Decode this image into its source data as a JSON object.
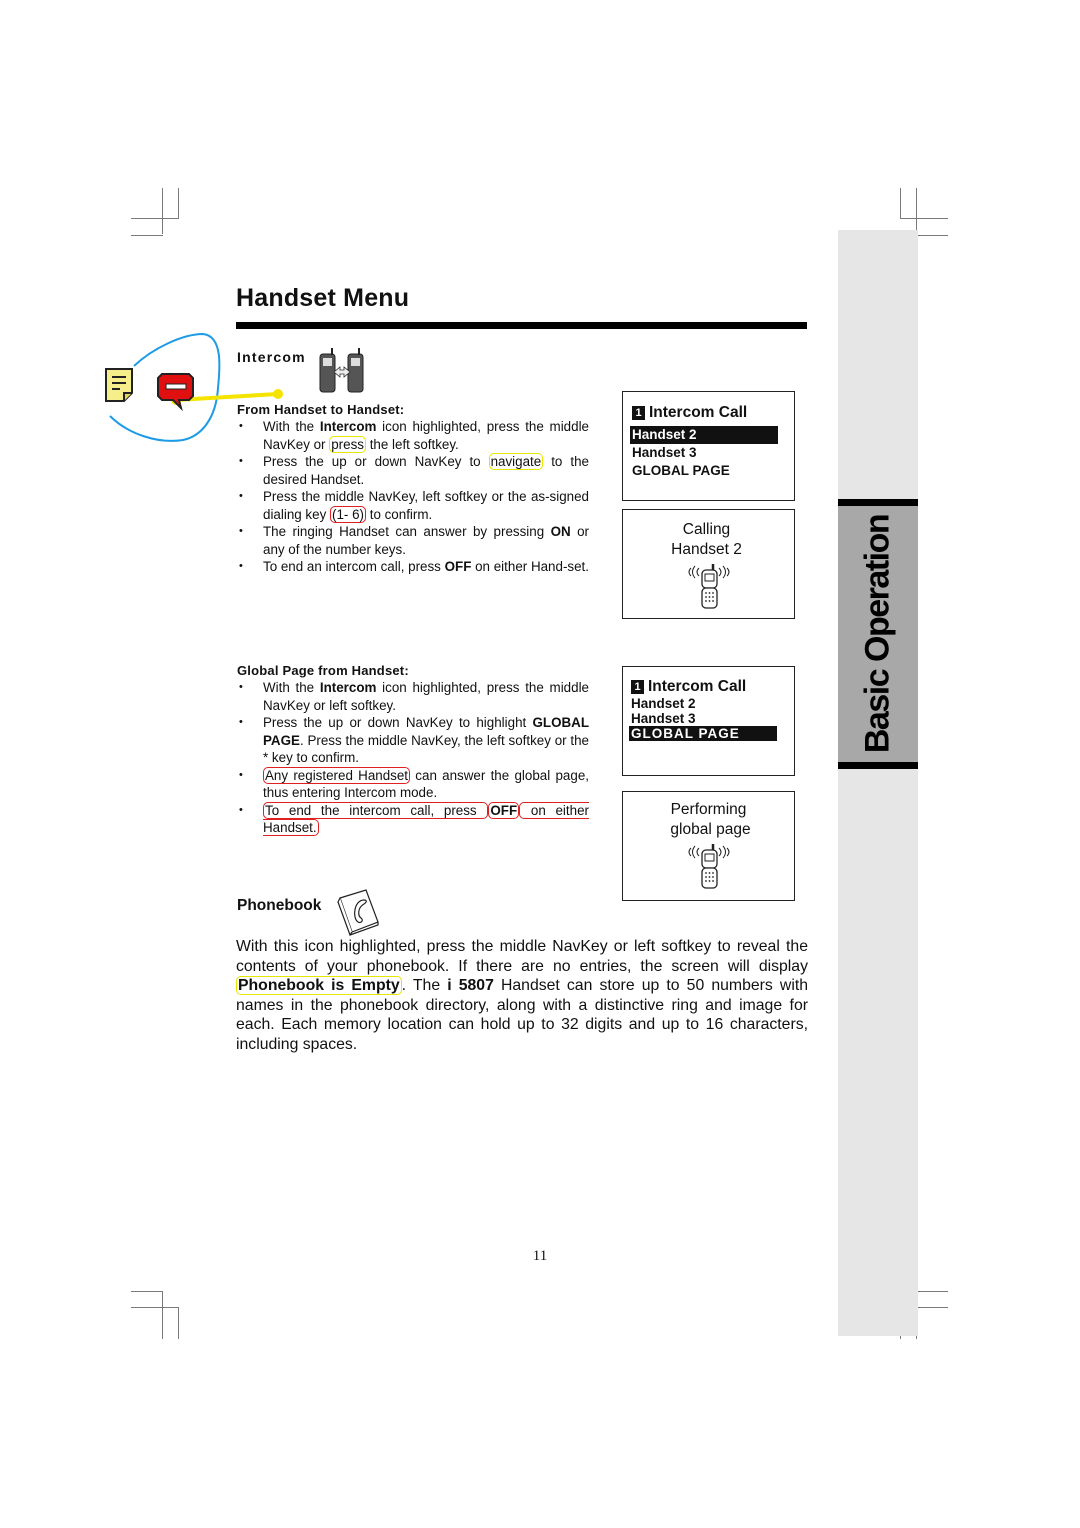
{
  "page": {
    "title": "Handset Menu",
    "side_tab": "Basic Operation",
    "page_number": "11"
  },
  "annotations": {
    "note_icon": "sticky-note-icon",
    "comment_icon": "comment-bubble-icon",
    "colors": {
      "circle": "#1e9be6",
      "connector": "#f5e400",
      "comment": "#e01010",
      "note": "#f5ee8a"
    }
  },
  "intercom": {
    "heading": "Intercom",
    "icon": "two-handsets-icon",
    "from_handset": {
      "heading": "From Handset to Handset:",
      "bullets": [
        {
          "parts": [
            {
              "t": "With the "
            },
            {
              "t": "Intercom",
              "b": true
            },
            {
              "t": " icon highlighted, press the middle NavKey or "
            },
            {
              "t": "press",
              "mark": "y"
            },
            {
              "t": " the left softkey."
            }
          ]
        },
        {
          "parts": [
            {
              "t": "Press the up or down NavKey to "
            },
            {
              "t": "navigate",
              "mark": "y"
            },
            {
              "t": " to the desired Handset."
            }
          ]
        },
        {
          "parts": [
            {
              "t": "Press the middle NavKey, left softkey or the as-signed dialing key "
            },
            {
              "t": "(1- 6)",
              "mark": "r"
            },
            {
              "t": " to confirm."
            }
          ]
        },
        {
          "parts": [
            {
              "t": "The ringing Handset can answer by pressing "
            },
            {
              "t": "ON",
              "b": true
            },
            {
              "t": " or any of the number keys."
            }
          ]
        },
        {
          "parts": [
            {
              "t": "To end an intercom call, press "
            },
            {
              "t": "OFF",
              "b": true
            },
            {
              "t": " on either Hand-set."
            }
          ]
        }
      ]
    },
    "global_page": {
      "heading": "Global Page from Handset:",
      "bullets": [
        {
          "parts": [
            {
              "t": "With the "
            },
            {
              "t": "Intercom",
              "b": true
            },
            {
              "t": " icon highlighted, press the middle NavKey or left softkey."
            }
          ]
        },
        {
          "parts": [
            {
              "t": "Press the up or down NavKey to highlight "
            },
            {
              "t": "GLOBAL PAGE",
              "b": true
            },
            {
              "t": ". Press the middle NavKey, the left softkey or the * key to confirm."
            }
          ]
        },
        {
          "parts": [
            {
              "t": "Any registered Handset",
              "mark": "r"
            },
            {
              "t": " can answer the global page, thus entering Intercom mode."
            }
          ]
        },
        {
          "parts": [
            {
              "t": "To end the intercom call, press ",
              "mark": "r"
            },
            {
              "t": "OFF",
              "b": true,
              "mark": "r"
            },
            {
              "t": " on either Handset.",
              "mark": "r"
            }
          ]
        }
      ]
    },
    "screens": {
      "menu1": {
        "num": "1",
        "title": "Intercom Call",
        "rows": [
          "Handset 2",
          "Handset 3",
          "GLOBAL PAGE"
        ],
        "selected": 0
      },
      "calling": {
        "line1": "Calling",
        "line2": "Handset 2",
        "icon": "ringing-handset-icon"
      },
      "menu2": {
        "num": "1",
        "title": "Intercom Call",
        "rows": [
          "Handset 2",
          "Handset 3",
          "GLOBAL  PAGE"
        ],
        "selected": 2
      },
      "paging": {
        "line1": "Performing",
        "line2": "global page",
        "icon": "ringing-handset-icon"
      }
    }
  },
  "phonebook": {
    "heading": "Phonebook",
    "icon": "phonebook-icon",
    "body": [
      {
        "t": "With this icon highlighted, press the middle NavKey or left softkey to reveal the contents of your phonebook. If there are no entries, the screen will display "
      },
      {
        "t": "Phonebook is Empty",
        "b": true,
        "mark": "y"
      },
      {
        "t": ". The "
      },
      {
        "t": "i 5807",
        "b": true
      },
      {
        "t": " Handset can store up to 50 numbers with names in the phonebook directory, along with a distinctive ring and image for each. Each memory location can hold up to 32 digits and up to 16 characters, including  spaces."
      }
    ]
  }
}
